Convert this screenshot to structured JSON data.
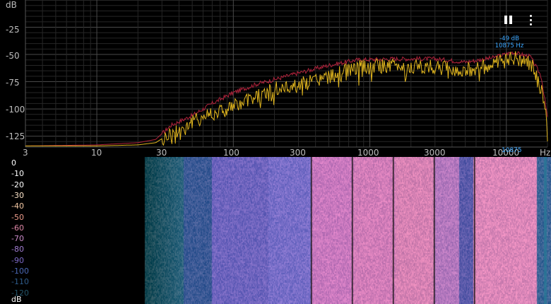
{
  "spectrum": {
    "y_unit": "dB",
    "y_ticks": [
      "-25",
      "-50",
      "-75",
      "-100",
      "-125"
    ],
    "x_ticks": [
      "3",
      "10",
      "30",
      "100",
      "300",
      "1000",
      "3000",
      "10000"
    ],
    "x_unit": "Hz",
    "cursor": {
      "level": "-49 dB",
      "frequency": "10875 Hz",
      "marker": "10875"
    }
  },
  "chart_data": {
    "type": "line",
    "x_scale": "log",
    "xlim": [
      3,
      20000
    ],
    "ylim": [
      -135,
      0
    ],
    "series": [
      {
        "color": "#b0233c",
        "x": [
          3,
          10,
          20,
          27,
          35,
          50,
          70,
          100,
          150,
          200,
          300,
          500,
          800,
          1500,
          3000,
          5000,
          8000,
          11000,
          15000,
          18000,
          20000
        ],
        "y": [
          -134,
          -133,
          -131,
          -128,
          -115,
          -106,
          -95,
          -85,
          -77,
          -73,
          -67,
          -60,
          -55,
          -54,
          -54,
          -57,
          -53,
          -48,
          -52,
          -70,
          -108
        ]
      },
      {
        "color": "#e0b51e",
        "x": [
          3,
          10,
          20,
          27,
          35,
          50,
          70,
          100,
          150,
          200,
          300,
          500,
          800,
          1500,
          3000,
          5000,
          8000,
          11000,
          15000,
          18000,
          20000
        ],
        "y": [
          -134,
          -134,
          -133,
          -131,
          -122,
          -112,
          -103,
          -98,
          -88,
          -82,
          -78,
          -70,
          -62,
          -60,
          -62,
          -64,
          -60,
          -52,
          -58,
          -80,
          -115
        ]
      }
    ]
  },
  "spectrogram": {
    "legend_unit": "dB",
    "legend": [
      {
        "label": "0",
        "color": "#ffffff"
      },
      {
        "label": "-10",
        "color": "#ffffff"
      },
      {
        "label": "-20",
        "color": "#ffffff"
      },
      {
        "label": "-30",
        "color": "#fbe3c8"
      },
      {
        "label": "-40",
        "color": "#f3c7a3"
      },
      {
        "label": "-50",
        "color": "#ec9b8a"
      },
      {
        "label": "-60",
        "color": "#de87a6"
      },
      {
        "label": "-70",
        "color": "#c98ac8"
      },
      {
        "label": "-80",
        "color": "#a07cd0"
      },
      {
        "label": "-90",
        "color": "#7c69c6"
      },
      {
        "label": "-100",
        "color": "#4a68b5"
      },
      {
        "label": "-110",
        "color": "#2f5c8c"
      },
      {
        "label": "-120",
        "color": "#24556a"
      }
    ]
  },
  "toolbar": {
    "pause": "pause-icon",
    "more": "more-vert-icon"
  }
}
